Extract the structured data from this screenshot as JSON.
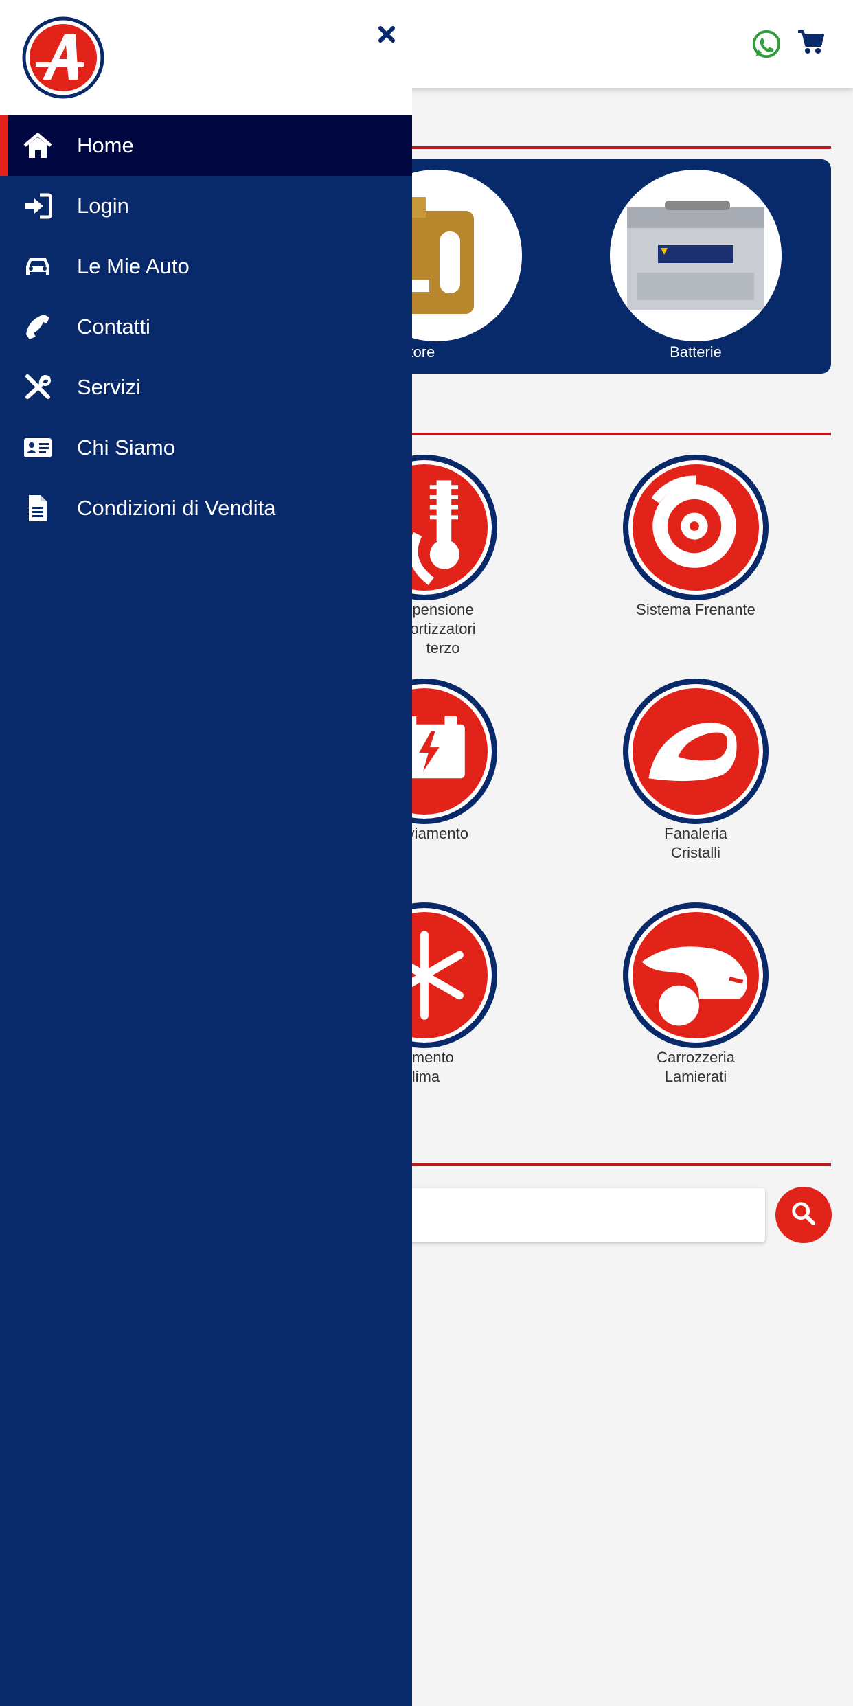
{
  "drawer": {
    "items": [
      {
        "label": "Home",
        "icon": "home-icon",
        "active": true
      },
      {
        "label": "Login",
        "icon": "login-icon"
      },
      {
        "label": "Le Mie Auto",
        "icon": "car-icon"
      },
      {
        "label": "Contatti",
        "icon": "phone-icon"
      },
      {
        "label": "Servizi",
        "icon": "tools-icon"
      },
      {
        "label": "Chi Siamo",
        "icon": "id-card-icon"
      },
      {
        "label": "Condizioni di Vendita",
        "icon": "document-icon"
      }
    ]
  },
  "featured": {
    "items": [
      {
        "label": "o motore"
      },
      {
        "label": "Batterie"
      }
    ]
  },
  "categories": [
    {
      "label": "pensione\nortizzatori\nterzo",
      "icon": "suspension-icon"
    },
    {
      "label": "Sistema Frenante",
      "icon": "brake-disc-icon"
    },
    {
      "label": "ne Avviamento",
      "icon": "battery-icon"
    },
    {
      "label": "Fanaleria\nCristalli",
      "icon": "mirror-icon"
    },
    {
      "label": "ddamento\nClima",
      "icon": "snowflake-icon"
    },
    {
      "label": "Carrozzeria\nLamierati",
      "icon": "car-body-icon"
    }
  ],
  "colors": {
    "navy": "#082a6b",
    "active_bg": "#000640",
    "brand_red": "#e2231a",
    "whatsapp_green": "#2e9e3a"
  }
}
